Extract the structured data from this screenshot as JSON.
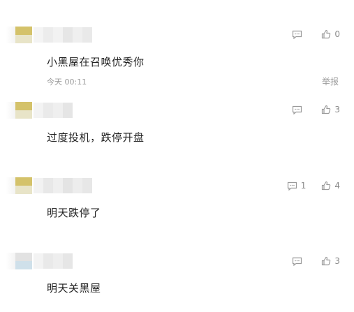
{
  "comments": [
    {
      "text": "小黑屋在召唤优秀你",
      "time": "今天 00:11",
      "report": "举报",
      "reply_count": "",
      "like_count": "0",
      "colors": {
        "avatar_top": "#d4c26a",
        "avatar_bottom": "#e8e4c8"
      }
    },
    {
      "text": "过度投机，跌停开盘",
      "reply_count": "",
      "like_count": "3",
      "colors": {
        "avatar_top": "#d4c26a",
        "avatar_bottom": "#e8e4c8"
      }
    },
    {
      "text": "明天跌停了",
      "reply_count": "1",
      "like_count": "4",
      "colors": {
        "avatar_top": "#d4c26a",
        "avatar_bottom": "#e8e4c8"
      }
    },
    {
      "text": "明天关黑屋",
      "reply_count": "",
      "like_count": "3",
      "colors": {
        "avatar_top": "#e2e2e2",
        "avatar_bottom": "#cfe0ea"
      }
    }
  ],
  "icons": {
    "reply": "comment-bubble-icon",
    "like": "thumbs-up-icon"
  }
}
